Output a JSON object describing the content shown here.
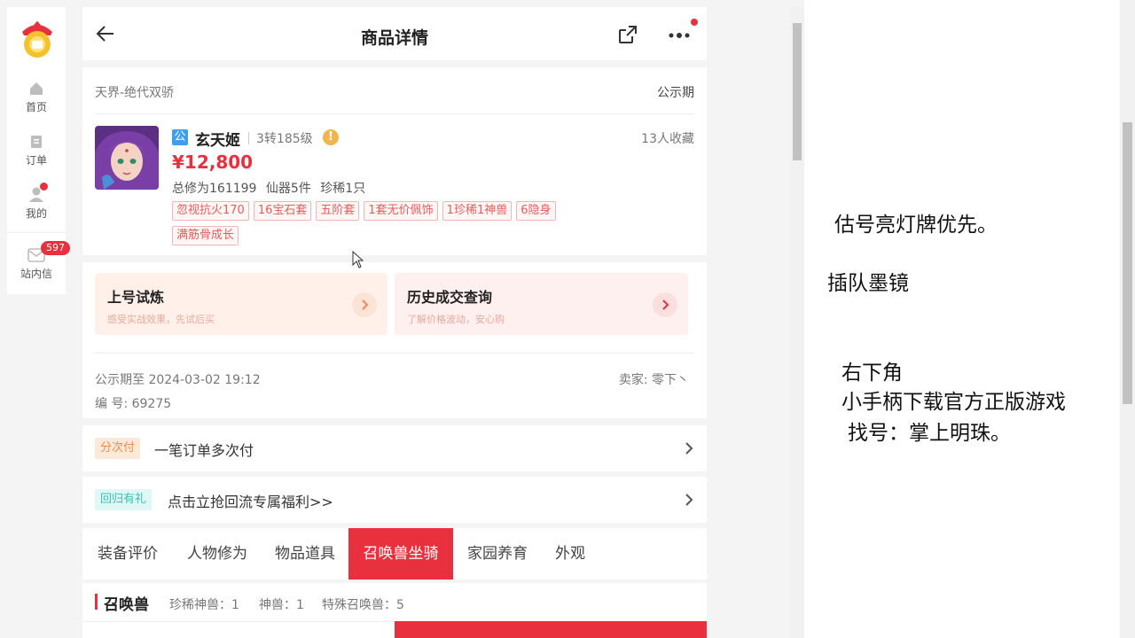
{
  "sidebar": {
    "items": [
      {
        "label": "首页",
        "icon": "home-icon"
      },
      {
        "label": "订单",
        "icon": "order-icon"
      },
      {
        "label": "我的",
        "icon": "user-icon"
      },
      {
        "label": "站内信",
        "icon": "mail-icon",
        "badge": "597"
      }
    ]
  },
  "header": {
    "title": "商品详情"
  },
  "product": {
    "server": "天界-绝代双骄",
    "status": "公示期",
    "badge": "公",
    "role_name": "玄天姬",
    "level": "3转185级",
    "favorites": "13人收藏",
    "price": "¥12,800",
    "stats": [
      "总修为161199",
      "仙器5件",
      "珍稀1只"
    ],
    "tags": [
      "忽视抗火170",
      "16宝石套",
      "五阶套",
      "1套无价佩饰",
      "1珍稀1神兽",
      "6隐身",
      "满筋骨成长"
    ]
  },
  "actions": [
    {
      "title": "上号试炼",
      "subtitle": "感受实战效果，先试后买"
    },
    {
      "title": "历史成交查询",
      "subtitle": "了解价格波动，安心购"
    }
  ],
  "meta": {
    "public_until": "公示期至 2024-03-02 19:12",
    "seller": "卖家: 零下丶",
    "serial": "编 号: 69275"
  },
  "rows": [
    {
      "tag": "分次付",
      "text": "一笔订单多次付"
    },
    {
      "tag": "回归有礼",
      "text": "点击立抢回流专属福利>>"
    }
  ],
  "tabs": [
    "装备评价",
    "人物修为",
    "物品道具",
    "召唤兽坐骑",
    "家园养育",
    "外观"
  ],
  "active_tab": "召唤兽坐骑",
  "pets": {
    "heading": "召唤兽",
    "counts": [
      "珍稀神兽：1",
      "神兽：1",
      "特殊召唤兽：5"
    ]
  },
  "notes": [
    "估号亮灯牌优先。",
    "插队墨镜",
    "右下角",
    "小手柄下载官方正版游戏",
    "找号：掌上明珠。"
  ],
  "colors": {
    "accent": "#e8303f",
    "tag_text": "#e85c5c",
    "tag_border": "#f3b5b5"
  }
}
